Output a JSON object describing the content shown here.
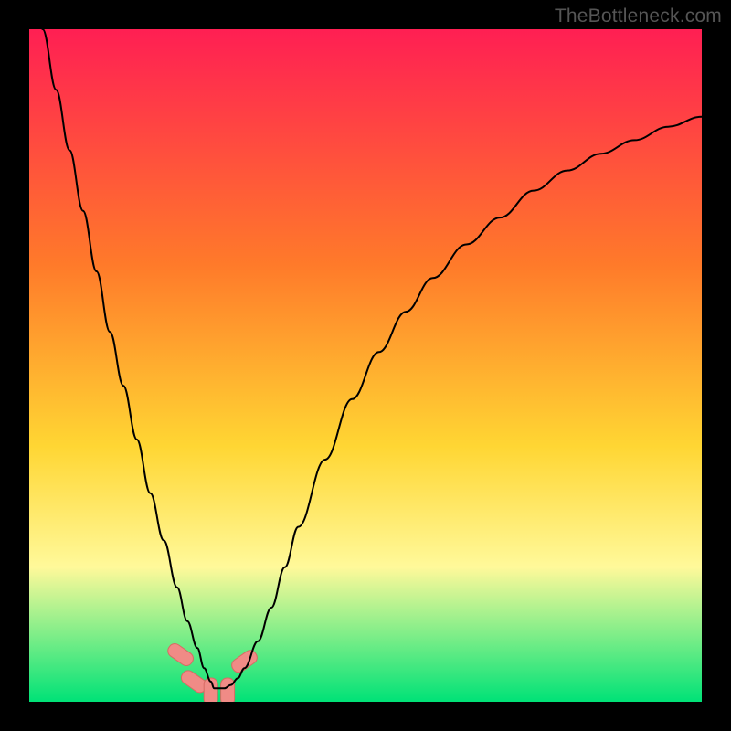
{
  "watermark": "TheBottleneck.com",
  "colors": {
    "frame": "#000000",
    "gradient_top": "#ff1f53",
    "gradient_mid1": "#ff7a2a",
    "gradient_mid2": "#ffd633",
    "gradient_mid3": "#fff99a",
    "gradient_bottom": "#00e277",
    "curve": "#000000",
    "marker_fill": "#f08b86",
    "marker_stroke": "#d86a63"
  },
  "chart_data": {
    "type": "line",
    "title": "",
    "xlabel": "",
    "ylabel": "",
    "xlim": [
      0,
      100
    ],
    "ylim": [
      0,
      100
    ],
    "series": [
      {
        "name": "bottleneck-curve",
        "x": [
          0,
          2,
          4,
          6,
          8,
          10,
          12,
          14,
          16,
          18,
          20,
          22,
          23.5,
          25,
          26,
          27,
          27.5,
          28,
          29,
          30,
          31,
          32,
          34,
          36,
          38,
          40,
          44,
          48,
          52,
          56,
          60,
          65,
          70,
          75,
          80,
          85,
          90,
          95,
          100
        ],
        "y": [
          110,
          100,
          91,
          82,
          73,
          64,
          55,
          47,
          39,
          31,
          24,
          17,
          12,
          8,
          5,
          3,
          2,
          2,
          2,
          2.5,
          3.5,
          5,
          9,
          14,
          20,
          26,
          36,
          45,
          52,
          58,
          63,
          68,
          72,
          76,
          79,
          81.5,
          83.5,
          85.5,
          87
        ]
      }
    ],
    "markers": [
      {
        "x": 22.5,
        "y": 7,
        "rot": -55
      },
      {
        "x": 24.5,
        "y": 3,
        "rot": -55
      },
      {
        "x": 27.0,
        "y": 1.5,
        "rot": 0
      },
      {
        "x": 29.5,
        "y": 1.5,
        "rot": 0
      },
      {
        "x": 32.0,
        "y": 6,
        "rot": 55
      }
    ]
  }
}
